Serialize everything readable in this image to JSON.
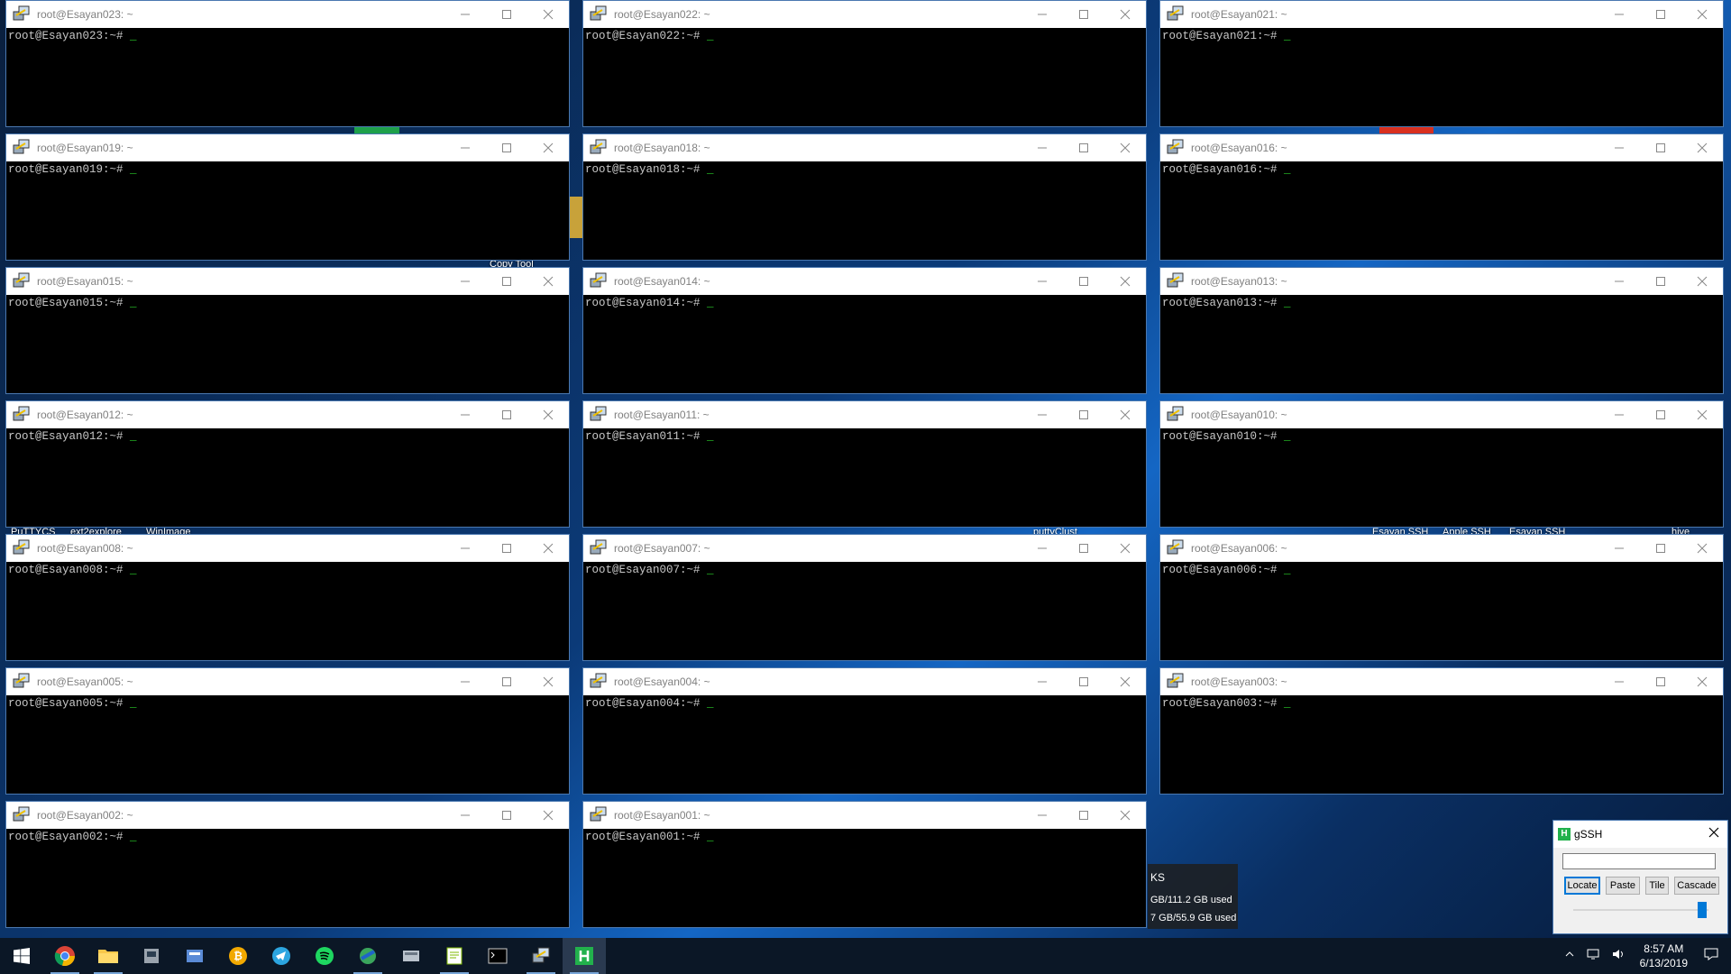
{
  "windows": [
    {
      "title": "root@Esayan023: ~",
      "prompt": "root@Esayan023:~#"
    },
    {
      "title": "root@Esayan022: ~",
      "prompt": "root@Esayan022:~#"
    },
    {
      "title": "root@Esayan021: ~",
      "prompt": "root@Esayan021:~#"
    },
    {
      "title": "root@Esayan019: ~",
      "prompt": "root@Esayan019:~#"
    },
    {
      "title": "root@Esayan018: ~",
      "prompt": "root@Esayan018:~#"
    },
    {
      "title": "root@Esayan016: ~",
      "prompt": "root@Esayan016:~#"
    },
    {
      "title": "root@Esayan015: ~",
      "prompt": "root@Esayan015:~#"
    },
    {
      "title": "root@Esayan014: ~",
      "prompt": "root@Esayan014:~#"
    },
    {
      "title": "root@Esayan013: ~",
      "prompt": "root@Esayan013:~#"
    },
    {
      "title": "root@Esayan012: ~",
      "prompt": "root@Esayan012:~#"
    },
    {
      "title": "root@Esayan011: ~",
      "prompt": "root@Esayan011:~#"
    },
    {
      "title": "root@Esayan010: ~",
      "prompt": "root@Esayan010:~#"
    },
    {
      "title": "root@Esayan008: ~",
      "prompt": "root@Esayan008:~#"
    },
    {
      "title": "root@Esayan007: ~",
      "prompt": "root@Esayan007:~#"
    },
    {
      "title": "root@Esayan006: ~",
      "prompt": "root@Esayan006:~#"
    },
    {
      "title": "root@Esayan005: ~",
      "prompt": "root@Esayan005:~#"
    },
    {
      "title": "root@Esayan004: ~",
      "prompt": "root@Esayan004:~#"
    },
    {
      "title": "root@Esayan003: ~",
      "prompt": "root@Esayan003:~#"
    },
    {
      "title": "root@Esayan002: ~",
      "prompt": "root@Esayan002:~#"
    },
    {
      "title": "root@Esayan001: ~",
      "prompt": "root@Esayan001:~#"
    }
  ],
  "cursor_char": "_",
  "desktop_labels": {
    "copy_tool": "Copy Tool",
    "puttycs": "PuTTYCS",
    "ext2explore": "ext2explore",
    "winimage": "WinImage",
    "puttyclust": "puttyClust",
    "esayan_ssh1": "Esayan SSH",
    "apple_ssh": "Apple SSH",
    "esayan_ssh2": "Esayan SSH",
    "hive": "hive"
  },
  "gssh": {
    "title": "gSSH",
    "input_value": "",
    "locate": "Locate",
    "paste": "Paste",
    "tile": "Tile",
    "cascade": "Cascade",
    "slider_fraction": 0.95
  },
  "disk": {
    "header": "KS",
    "line1": "GB/111.2 GB used",
    "line2": "7 GB/55.9 GB used"
  },
  "clock": {
    "time": "8:57 AM",
    "date": "6/13/2019"
  },
  "taskbar": [
    "windows-start",
    "chrome",
    "file-explorer",
    "app",
    "app2",
    "bitcoin",
    "telegram",
    "spotify",
    "app3",
    "app4",
    "notepad",
    "terminal",
    "putty",
    "gssh"
  ],
  "colors": {
    "accent": "#0078d7",
    "cursor": "#2bd62b",
    "titlebar": "#ffffff"
  }
}
